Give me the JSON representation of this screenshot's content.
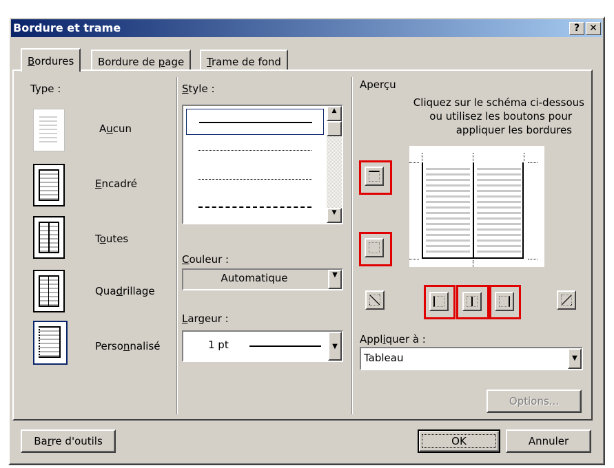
{
  "window": {
    "title": "Bordure et trame",
    "help_btn": "?",
    "close_btn": "✕"
  },
  "tabs": [
    {
      "label": "Bordures",
      "key": "B",
      "rest": "ordures",
      "pre": ""
    },
    {
      "label": "Bordure de page",
      "pre": "Bordure de ",
      "key": "p",
      "rest": "age"
    },
    {
      "label": "Trame de fond",
      "pre": "",
      "key": "T",
      "rest": "rame de fond"
    }
  ],
  "type_section": {
    "label": "Type :",
    "items": [
      {
        "pre": "A",
        "key": "u",
        "rest": "cun",
        "icon": "no-border-icon"
      },
      {
        "pre": "",
        "key": "E",
        "rest": "ncadré",
        "icon": "box-border-icon"
      },
      {
        "pre": "T",
        "key": "o",
        "rest": "utes",
        "icon": "all-borders-icon"
      },
      {
        "pre": "Qua",
        "key": "d",
        "rest": "rillage",
        "icon": "grid-border-icon"
      },
      {
        "pre": "Perso",
        "key": "n",
        "rest": "nalisé",
        "icon": "custom-border-icon"
      }
    ]
  },
  "style_section": {
    "key": "S",
    "rest": "tyle :"
  },
  "color_section": {
    "key": "C",
    "rest": "ouleur :",
    "value": "Automatique"
  },
  "width_section": {
    "key": "L",
    "rest": "argeur :",
    "value": "1 pt"
  },
  "preview": {
    "label": "Aperçu",
    "instr1": "Cliquez sur le schéma ci-dessous",
    "instr2": "ou utilisez les boutons pour",
    "instr3": "appliquer les bordures"
  },
  "apply": {
    "pre": "Appl",
    "key": "i",
    "rest": "quer à :",
    "value": "Tableau"
  },
  "buttons": {
    "options": "Options...",
    "toolbar_pre": "Ba",
    "toolbar_key": "r",
    "toolbar_rest": "re d'outils",
    "ok": "OK",
    "cancel": "Annuler"
  },
  "colors": {
    "title_start": "#0a246a",
    "title_end": "#a6caf0",
    "highlight": "#e00000",
    "face": "#d4d0c8"
  }
}
